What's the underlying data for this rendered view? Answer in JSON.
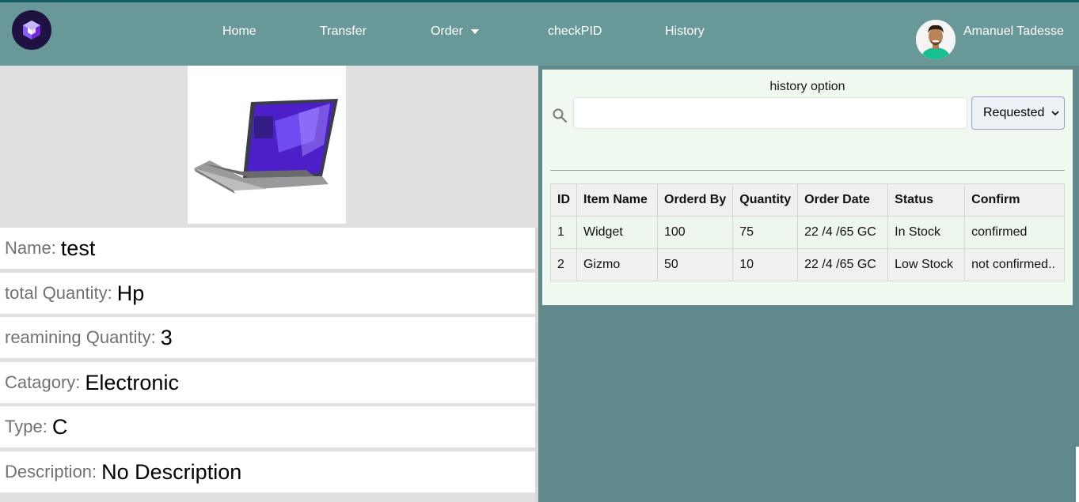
{
  "nav": {
    "items": [
      "Home",
      "Transfer",
      "Order",
      "checkPID",
      "History"
    ],
    "user_name": "Amanuel Tadesse"
  },
  "product": {
    "fields": [
      {
        "label": "Name:",
        "value": "test"
      },
      {
        "label": "total Quantity:",
        "value": "Hp"
      },
      {
        "label": "reamining Quantity:",
        "value": "3"
      },
      {
        "label": "Catagory:",
        "value": "Electronic"
      },
      {
        "label": "Type:",
        "value": "C"
      },
      {
        "label": "Description:",
        "value": "No Description"
      }
    ]
  },
  "history": {
    "title": "history option",
    "search_value": "",
    "filter_selected": "Requested",
    "columns": [
      "ID",
      "Item Name",
      "Orderd By",
      "Quantity",
      "Order Date",
      "Status",
      "Confirm"
    ],
    "rows": [
      [
        "1",
        "Widget",
        "100",
        "75",
        "22 /4 /65 GC",
        "In Stock",
        "confirmed"
      ],
      [
        "2",
        "Gizmo",
        "50",
        "10",
        "22 /4 /65 GC",
        "Low Stock",
        "not confirmed.."
      ]
    ]
  },
  "colors": {
    "navbar": "#689897",
    "page_background": "#61888a",
    "panel_background": "#eff9ef",
    "logo_background": "#1f1240"
  },
  "icons": [
    "logo-icon",
    "chevron-down-icon",
    "avatar-image",
    "laptop-image",
    "search-icon",
    "select-chevron-icon"
  ]
}
